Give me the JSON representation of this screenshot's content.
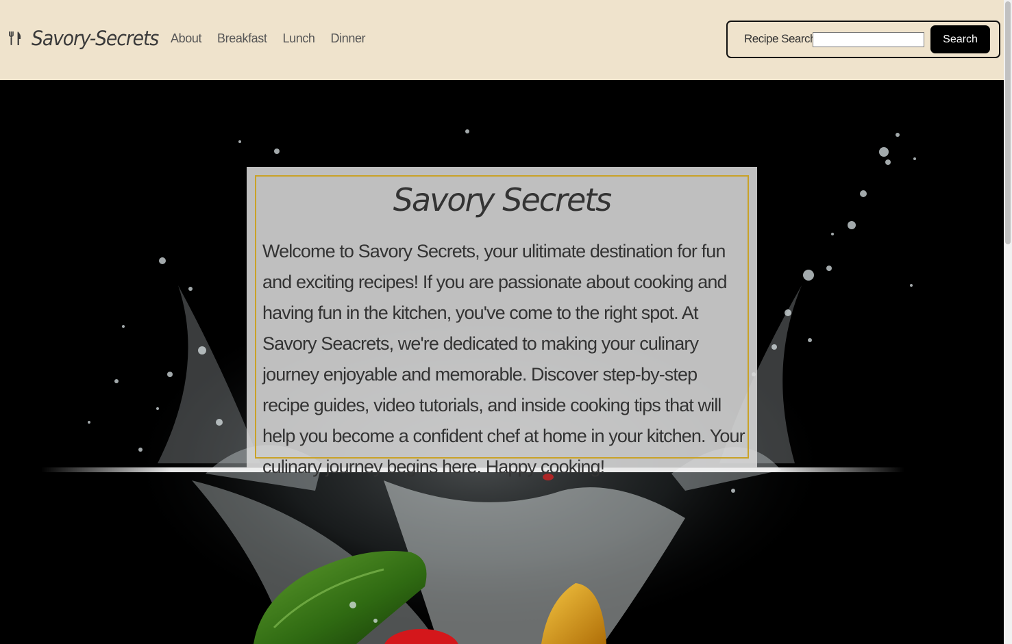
{
  "header": {
    "brand_icon": "utensils-icon",
    "brand_name": "Savory-Secrets",
    "nav": [
      "About",
      "Breakfast",
      "Lunch",
      "Dinner"
    ],
    "search_label": "Recipe Search:",
    "search_placeholder": "",
    "search_value": "",
    "search_button": "Search"
  },
  "hero": {
    "title": "Savory Secrets",
    "body": "Welcome to Savory Secrets, your ulitimate destination for fun and exciting recipes! If you are passionate about cooking and having fun in the kitchen, you've come to the right spot. At Savory Seacrets, we're dedicated to making your culinary journey enjoyable and memorable. Discover step-by-step recipe guides, video tutorials, and inside cooking tips that will help you become a confident chef at home in your kitchen. Your culinary journey begins here. Happy cooking!",
    "background": "vegetables-splashing-into-water-photo"
  },
  "colors": {
    "header_bg": "#efe3cc",
    "card_border": "#c9a227",
    "button_bg": "#000000",
    "text": "#333333"
  }
}
